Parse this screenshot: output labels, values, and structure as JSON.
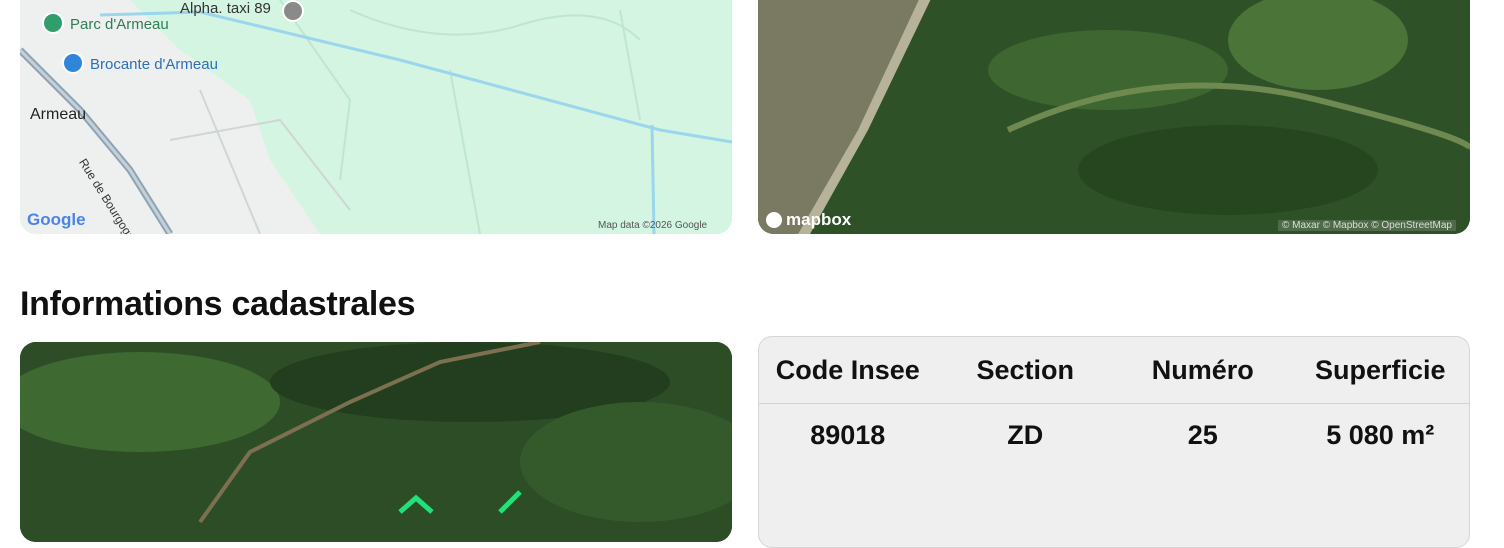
{
  "map_panel": {
    "places": [
      {
        "name": "Alpha. taxi 89",
        "icon": "taxi-icon"
      },
      {
        "name": "Parc d'Armeau",
        "icon": "park-tree-icon"
      },
      {
        "name": "Brocante d'Armeau",
        "icon": "shopping-bag-icon"
      }
    ],
    "town": "Armeau",
    "road": "Rue de Bourgogne",
    "logo": "Google",
    "attribution": "Map data ©2026 Google"
  },
  "satellite_panel": {
    "logo": "mapbox",
    "attribution": "© Maxar © Mapbox © OpenStreetMap"
  },
  "section_title": "Informations cadastrales",
  "cadastre_table": {
    "headers": [
      "Code Insee",
      "Section",
      "Numéro",
      "Superficie"
    ],
    "row": [
      "89018",
      "ZD",
      "25",
      "5 080 m²"
    ]
  },
  "colors": {
    "map_bg": "#d3f5e1",
    "river": "#9bd6ec",
    "parcel_outline": "#22e07a",
    "place_pin_green": "#2f9e6a",
    "place_pin_blue": "#2f86d8"
  }
}
